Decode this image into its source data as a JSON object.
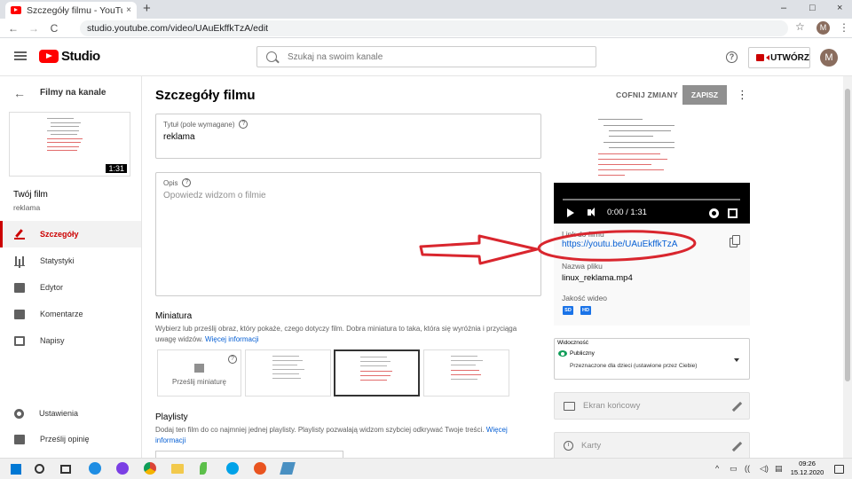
{
  "browser": {
    "tab_title": "Szczegóły filmu - YouTube Studio",
    "tab_close": "×",
    "new_tab": "+",
    "window_controls": [
      "–",
      "□",
      "×"
    ],
    "url": "studio.youtube.com/video/UAuEkffkTzA/edit",
    "profile_initial": "M",
    "nav": {
      "back": "←",
      "forward": "→",
      "reload": "C"
    }
  },
  "header": {
    "logo_text": "Studio",
    "search_placeholder": "Szukaj na swoim kanale",
    "help": "?",
    "create_label": "UTWÓRZ",
    "avatar_initial": "M"
  },
  "sidebar": {
    "back_label": "Filmy na kanale",
    "thumb_duration": "1:31",
    "your_film": "Twój film",
    "film_title": "reklama",
    "items": [
      {
        "label": "Szczegóły",
        "icon": "pencil-icon",
        "active": true
      },
      {
        "label": "Statystyki",
        "icon": "analytics-icon",
        "active": false
      },
      {
        "label": "Edytor",
        "icon": "film-icon",
        "active": false
      },
      {
        "label": "Komentarze",
        "icon": "comments-icon",
        "active": false
      },
      {
        "label": "Napisy",
        "icon": "subtitles-icon",
        "active": false
      }
    ],
    "bottom_items": [
      {
        "label": "Ustawienia",
        "icon": "gear-icon"
      },
      {
        "label": "Prześlij opinię",
        "icon": "feedback-icon"
      }
    ]
  },
  "main": {
    "page_title": "Szczegóły filmu",
    "undo_label": "COFNIJ ZMIANY",
    "save_label": "ZAPISZ",
    "more": "⋮",
    "title_field": {
      "label": "Tytuł (pole wymagane)",
      "value": "reklama",
      "help": "?"
    },
    "desc_field": {
      "label": "Opis",
      "placeholder": "Opowiedz widzom o filmie",
      "help": "?"
    },
    "thumbnail": {
      "heading": "Miniatura",
      "description": "Wybierz lub prześlij obraz, który pokaże, czego dotyczy film. Dobra miniatura to taka, która się wyróżnia i przyciąga uwagę widzów.",
      "link": "Więcej informacji",
      "upload_label": "Prześlij miniaturę",
      "help": "?"
    },
    "playlists": {
      "heading": "Playlisty",
      "description": "Dodaj ten film do co najmniej jednej playlisty. Playlisty pozwalają widzom szybciej odkrywać Twoje treści.",
      "link": "Więcej informacji"
    }
  },
  "right": {
    "player": {
      "time": "0:00 / 1:31"
    },
    "link_label": "Link do filmu",
    "link_value": "https://youtu.be/UAuEkffkTzA",
    "filename_label": "Nazwa pliku",
    "filename_value": "linux_reklama.mp4",
    "quality_label": "Jakość wideo",
    "quality_badges": [
      "SD",
      "HD"
    ],
    "visibility": {
      "label": "Widoczność",
      "value": "Publiczny",
      "sub": "Przeznaczone dla dzieci (ustawione przez Ciebie)"
    },
    "end_screen": "Ekran końcowy",
    "cards": "Karty"
  },
  "annotation_colors": {
    "ellipse": "#d9262e",
    "arrow": "#d9262e"
  },
  "taskbar": {
    "time": "09:26",
    "date": "15.12.2020",
    "tray_icons": [
      "^",
      "▭",
      "((",
      "◁)",
      "▤"
    ]
  },
  "colors": {
    "brand": "#ff0000",
    "link": "#065fd4",
    "active_nav": "#cc0000"
  }
}
